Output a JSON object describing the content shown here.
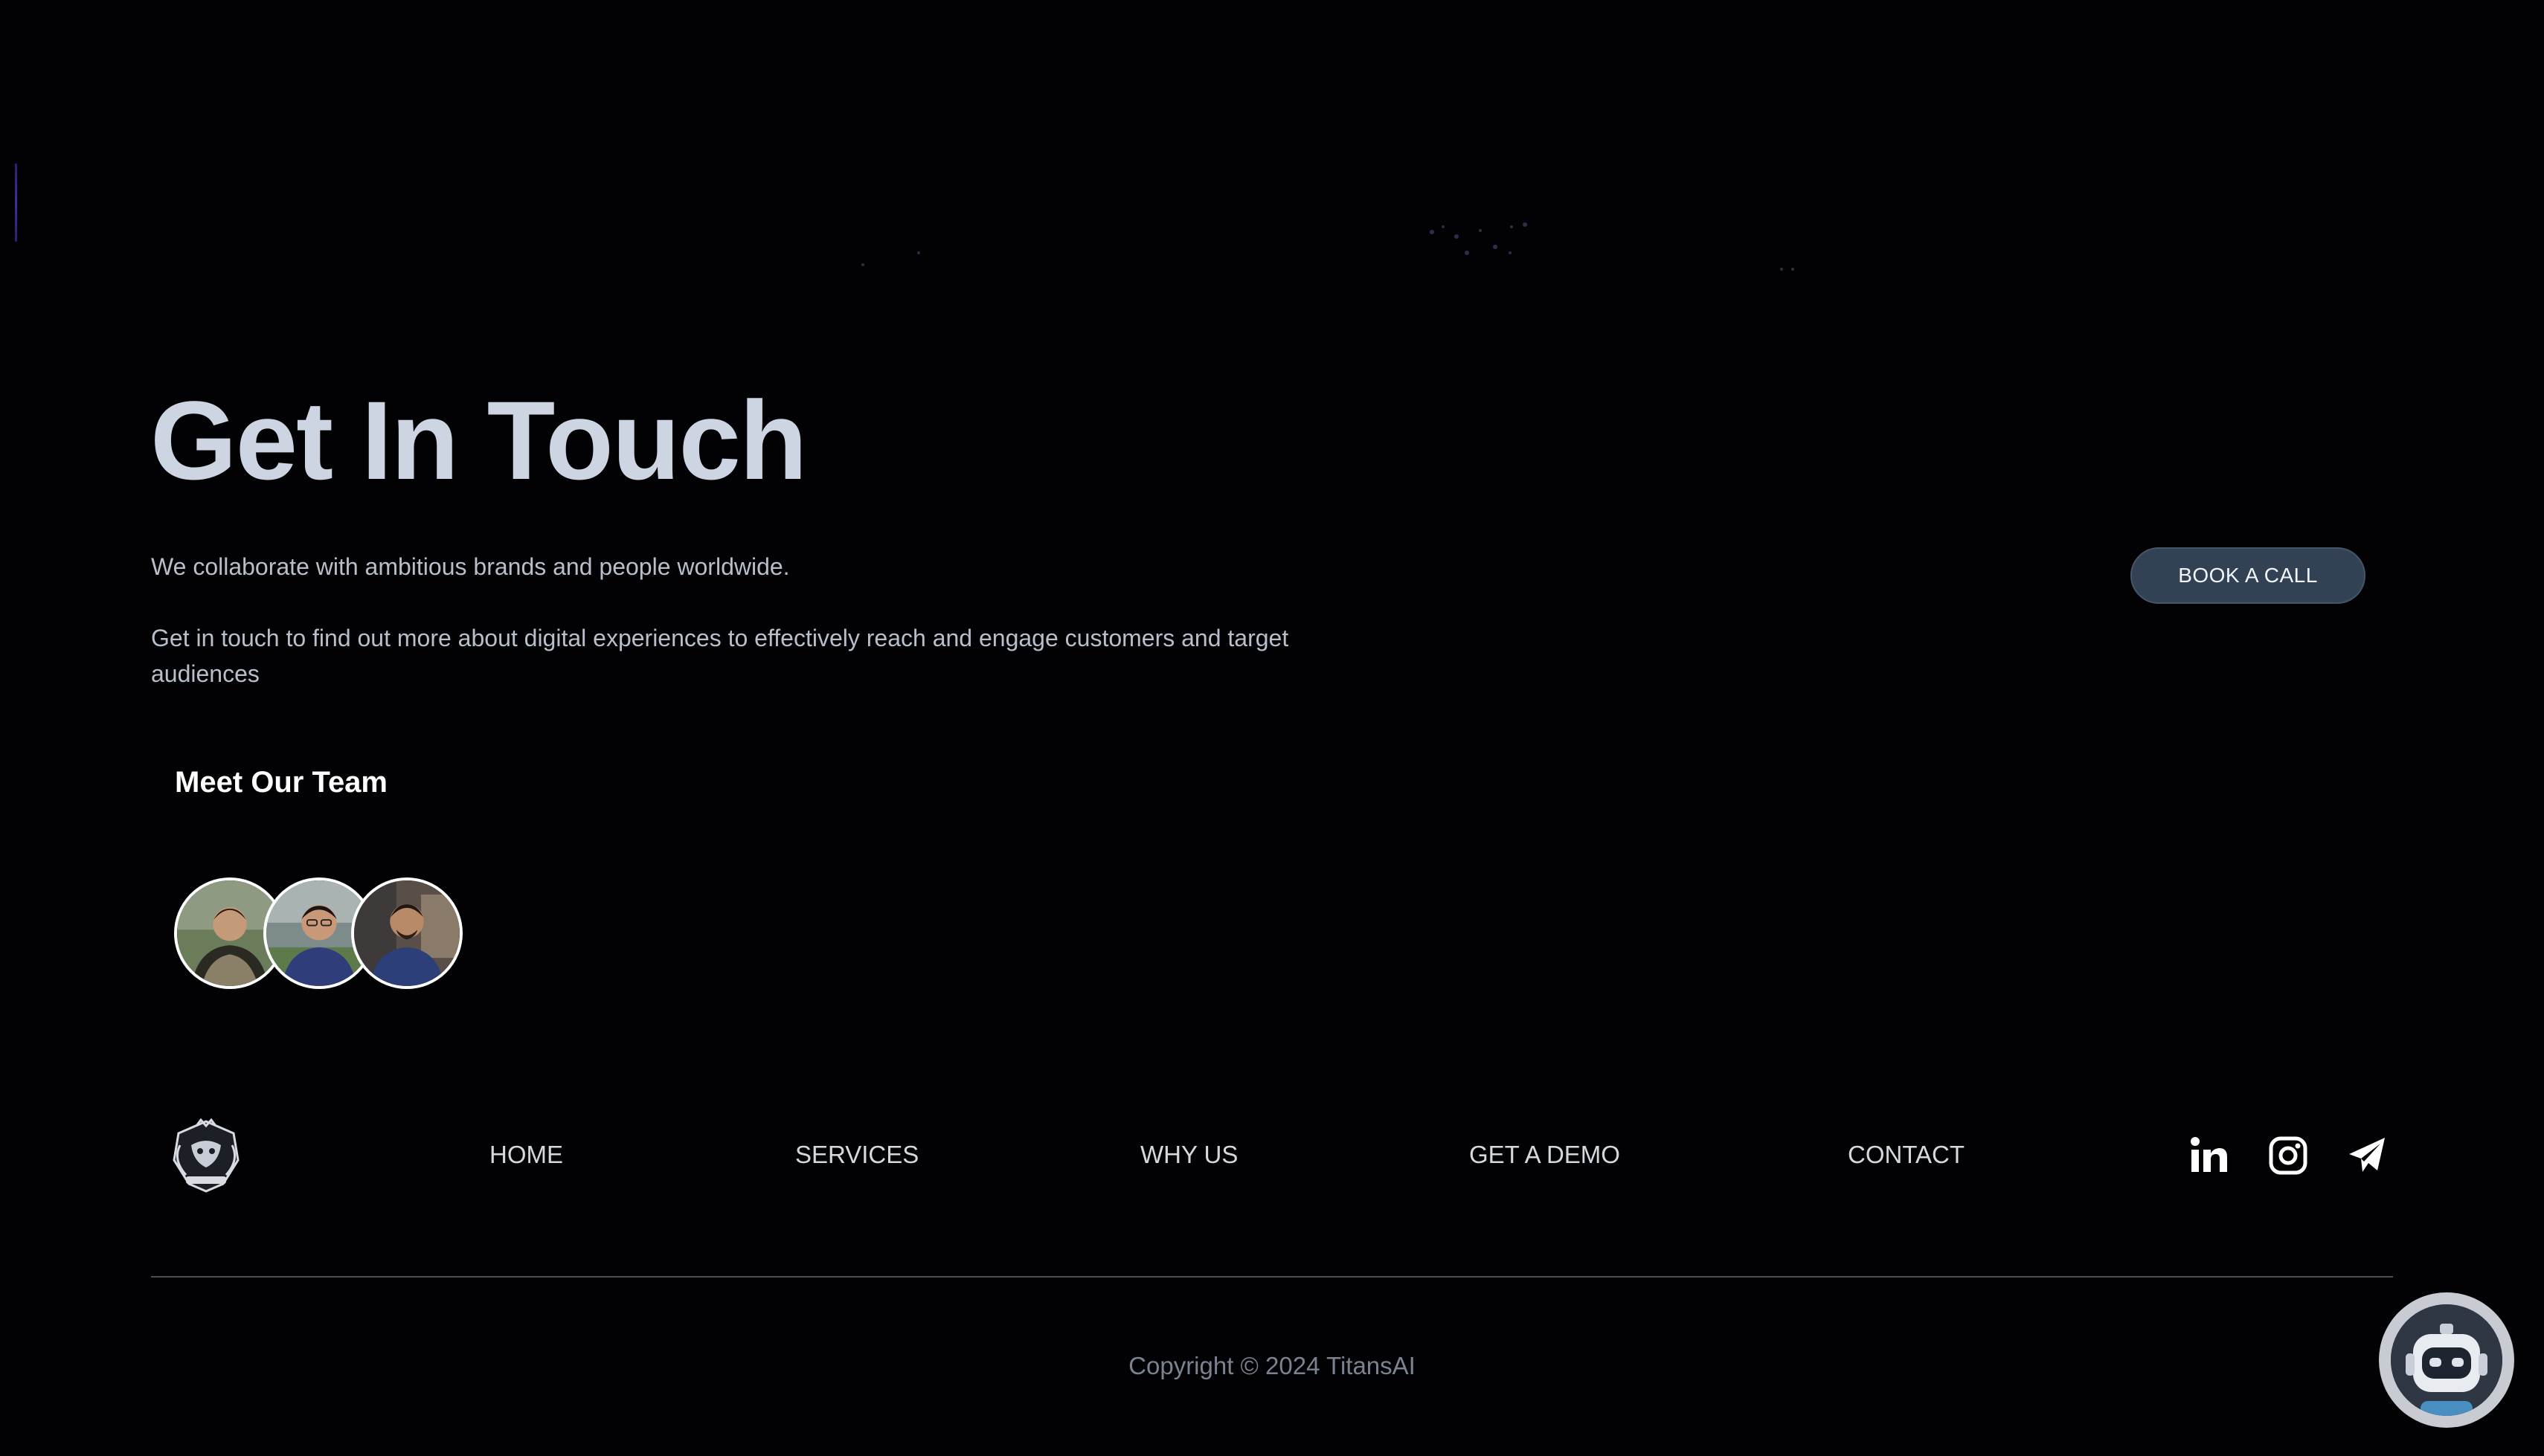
{
  "hero": {
    "title": "Get In Touch",
    "lead": "We collaborate with ambitious brands and people worldwide.",
    "description": "Get in touch to find out more about digital experiences to effectively reach and engage customers and target audiences"
  },
  "cta": {
    "book_call_label": "BOOK A CALL"
  },
  "team": {
    "title": "Meet Our Team",
    "members": [
      {
        "avatar": "team-member-avatar-1"
      },
      {
        "avatar": "team-member-avatar-2"
      },
      {
        "avatar": "team-member-avatar-3"
      }
    ]
  },
  "footer": {
    "logo": "titansai-logo",
    "nav": [
      {
        "label": "HOME"
      },
      {
        "label": "SERVICES"
      },
      {
        "label": "WHY US"
      },
      {
        "label": "GET A DEMO"
      },
      {
        "label": "CONTACT"
      }
    ],
    "social": [
      {
        "icon": "linkedin-icon"
      },
      {
        "icon": "instagram-icon"
      },
      {
        "icon": "telegram-icon"
      }
    ],
    "copyright": "Copyright © 2024 TitansAI"
  },
  "chatbot": {
    "icon": "robot-icon"
  },
  "colors": {
    "background": "#020204",
    "title": "#cdd5e3",
    "button": "#334155",
    "text": "#b8bfcb"
  }
}
